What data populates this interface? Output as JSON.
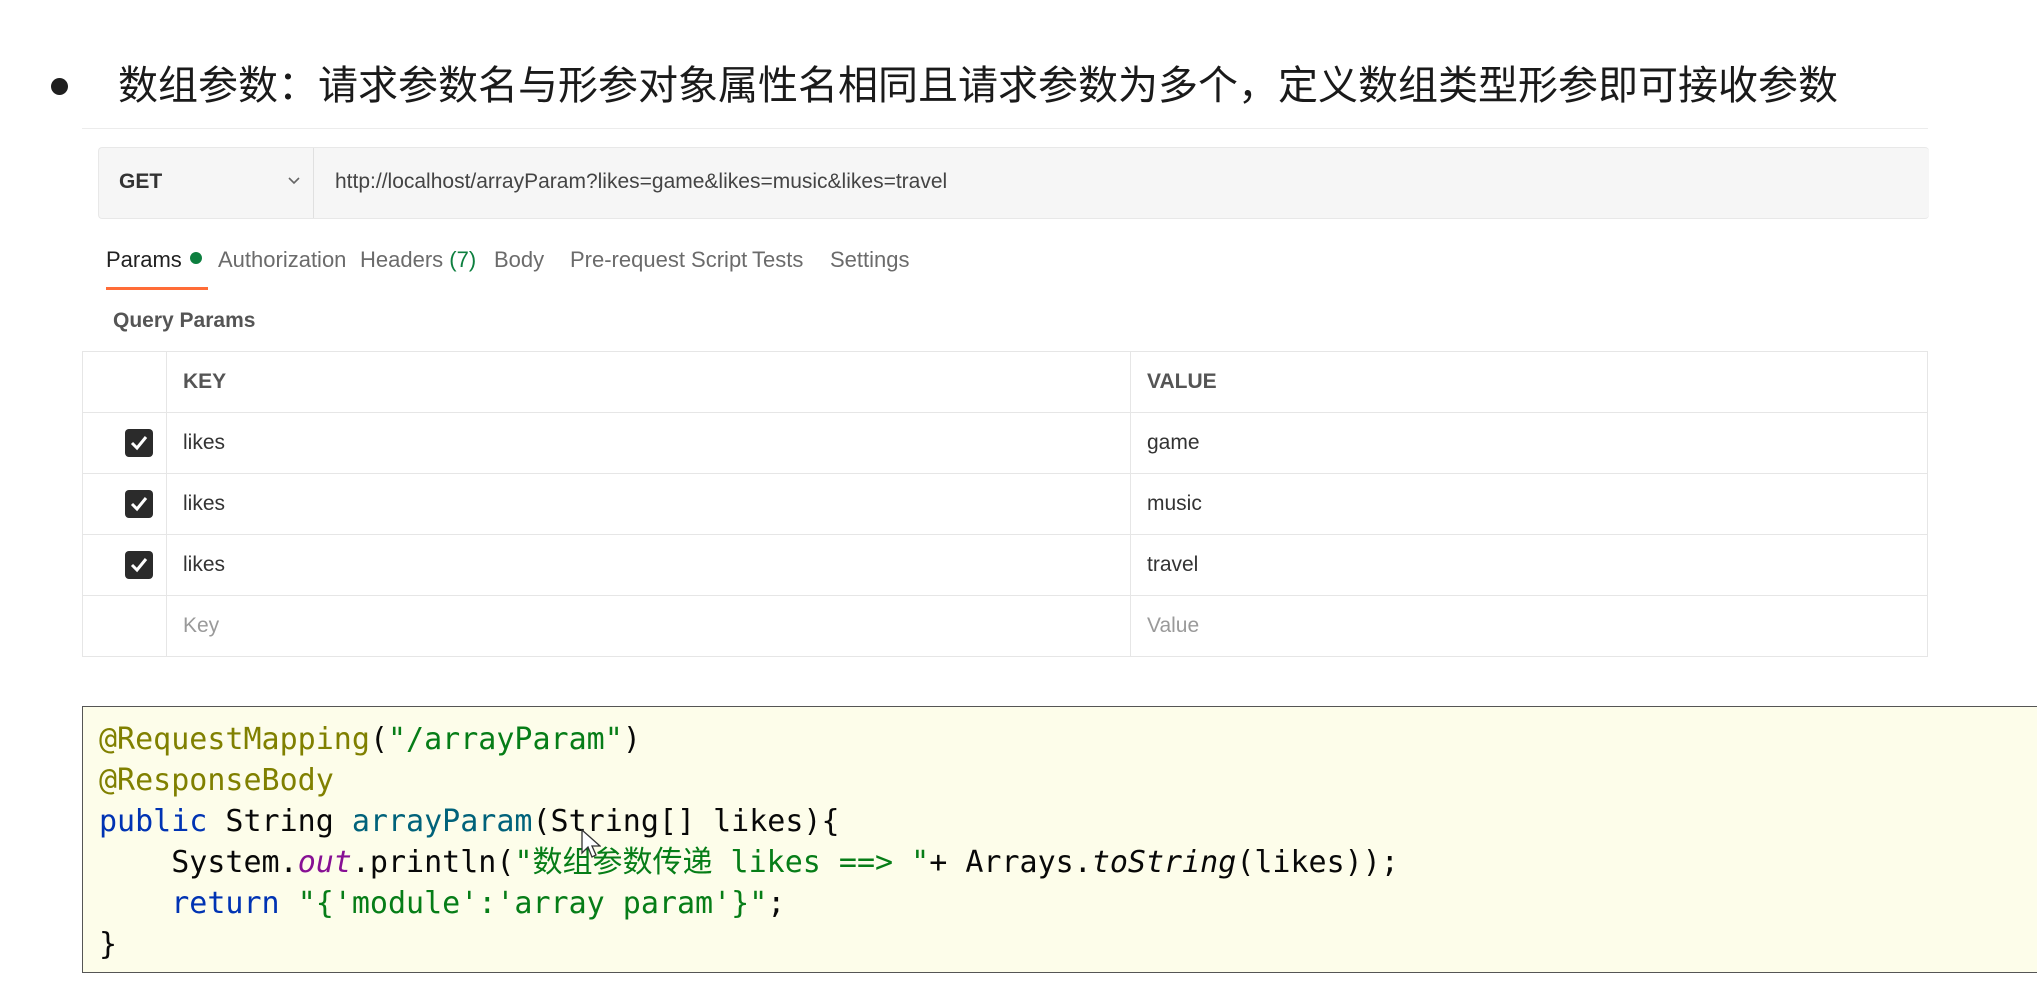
{
  "heading": {
    "text": "数组参数：请求参数名与形参对象属性名相同且请求参数为多个，定义数组类型形参即可接收参数"
  },
  "request": {
    "method": "GET",
    "url": "http://localhost/arrayParam?likes=game&likes=music&likes=travel"
  },
  "tabs": [
    {
      "label": "Params",
      "active": true,
      "indicator": "green-dot"
    },
    {
      "label": "Authorization"
    },
    {
      "label": "Headers",
      "count": "(7)"
    },
    {
      "label": "Body"
    },
    {
      "label": "Pre-request Script"
    },
    {
      "label": "Tests"
    },
    {
      "label": "Settings"
    }
  ],
  "query_params": {
    "title": "Query Params",
    "columns": {
      "key": "KEY",
      "value": "VALUE"
    },
    "rows": [
      {
        "checked": true,
        "key": "likes",
        "value": "game"
      },
      {
        "checked": true,
        "key": "likes",
        "value": "music"
      },
      {
        "checked": true,
        "key": "likes",
        "value": "travel"
      }
    ],
    "placeholder": {
      "key": "Key",
      "value": "Value"
    }
  },
  "code": {
    "line1": {
      "annotation": "@RequestMapping",
      "open": "(",
      "string": "\"/arrayParam\"",
      "close": ")"
    },
    "line2": {
      "annotation": "@ResponseBody"
    },
    "line3": {
      "kw": "public",
      "type": " String ",
      "method": "arrayParam",
      "rest": "(String[] likes){"
    },
    "line4": {
      "indent": "    ",
      "a": "System.",
      "field": "out",
      "b": ".println(",
      "string": "\"数组参数传递 likes ==> \"",
      "c": "+ Arrays.",
      "static": "toString",
      "d": "(likes));"
    },
    "line5": {
      "indent": "    ",
      "kw": "return",
      "sp": " ",
      "string": "\"{'module':'array param'}\"",
      "end": ";"
    },
    "line6": {
      "text": "}"
    }
  },
  "colors": {
    "accent_tab_underline": "#ff6c37",
    "status_green": "#0d7f3f",
    "code_background": "#fdfdea"
  }
}
